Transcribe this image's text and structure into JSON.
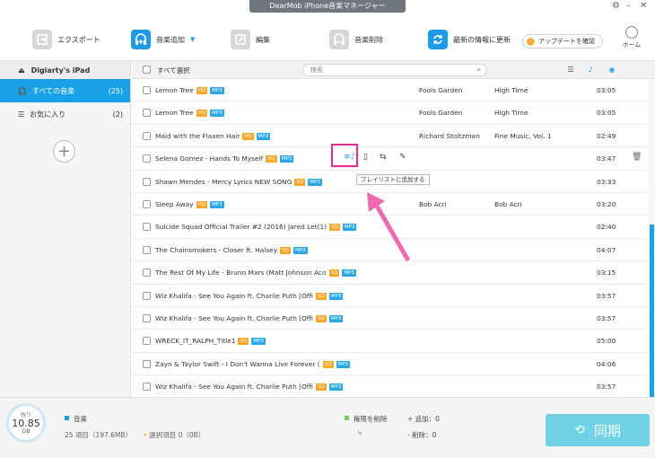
{
  "app": {
    "title": "DearMob iPhone音楽マネージャー"
  },
  "toolbar": {
    "export": "エクスポート",
    "add_music": "音楽追加",
    "edit": "編集",
    "delete_music": "音楽削除",
    "latest_info_update": "最新の情報に更新",
    "check_update": "アップデートを確認",
    "home": "ホーム"
  },
  "sidebar": {
    "device": "Digiarty's iPad",
    "items": [
      {
        "label": "すべての音楽",
        "count": "(25)"
      },
      {
        "label": "お気に入り",
        "count": "(2)"
      }
    ]
  },
  "list": {
    "select_all": "すべて選択",
    "search_placeholder": "検索",
    "tooltip": "プレイリストに追加する",
    "rows": [
      {
        "title": "Lemon Tree",
        "q": "HQ",
        "fmt": "MP3",
        "artist": "Fools Garden",
        "album": "High Time",
        "duration": "03:05"
      },
      {
        "title": "Lemon Tree",
        "q": "HQ",
        "fmt": "MP3",
        "artist": "Fools Garden",
        "album": "High Time",
        "duration": "03:05"
      },
      {
        "title": "Maid with the Flaxen Hair",
        "q": "HQ",
        "fmt": "MP3",
        "artist": "Richard Stoltzman",
        "album": "Fine Music, Vol. 1",
        "duration": "02:49"
      },
      {
        "title": "Selena Gomez - Hands To Myself",
        "q": "HQ",
        "fmt": "MP3",
        "artist": "",
        "album": "",
        "duration": "03:47"
      },
      {
        "title": "Shawn Mendes - Mercy Lyrics NEW SONG",
        "q": "SQ",
        "fmt": "MP3",
        "artist": "",
        "album": "",
        "duration": "03:33"
      },
      {
        "title": "Sleep Away",
        "q": "HQ",
        "fmt": "MP3",
        "artist": "Bob Acri",
        "album": "Bob Acri",
        "duration": "03:20"
      },
      {
        "title": "Suicide Squad Official Trailer #2 (2016) Jared Let(1)",
        "q": "SQ",
        "fmt": "MP3",
        "artist": "",
        "album": "",
        "duration": "02:40"
      },
      {
        "title": "The Chainsmokers - Closer ft. Halsey",
        "q": "SQ",
        "fmt": "MP3",
        "artist": "",
        "album": "",
        "duration": "04:07"
      },
      {
        "title": "The Rest Of My Life - Bruno Mars (Matt Johnson Aco",
        "q": "SQ",
        "fmt": "MP3",
        "artist": "",
        "album": "",
        "duration": "03:15"
      },
      {
        "title": "Wiz Khalifa - See You Again ft. Charlie Puth [Offi",
        "q": "SQ",
        "fmt": "MP3",
        "artist": "",
        "album": "",
        "duration": "03:57"
      },
      {
        "title": "Wiz Khalifa - See You Again ft. Charlie Puth [Offi",
        "q": "SQ",
        "fmt": "MP3",
        "artist": "",
        "album": "",
        "duration": "03:57"
      },
      {
        "title": "WRECK_IT_RALPH_Title1",
        "q": "SQ",
        "fmt": "MP3",
        "artist": "",
        "album": "",
        "duration": "05:00"
      },
      {
        "title": "Zayn & Taylor Swift - I Don't Wanna Live Forever (",
        "q": "SQ",
        "fmt": "MP3",
        "artist": "",
        "album": "",
        "duration": "04:06"
      },
      {
        "title": "Wiz Khalifa - See You Again ft. Charlie Puth [Offi",
        "q": "SQ",
        "fmt": "MP3",
        "artist": "",
        "album": "",
        "duration": "03:57"
      }
    ]
  },
  "bottom": {
    "storage_label": "残り",
    "storage_value": "10.85",
    "storage_unit": "GB",
    "music_label": "音楽",
    "summary": "25 項目（197.6MB）",
    "selected": "選択項目 0（0B）",
    "auth_delete": "権限を削除",
    "add_count": "+ 追加：0",
    "del_count": "- 削除：0",
    "sync": "同期"
  },
  "colors": {
    "accent": "#1aa0e6",
    "highlight": "#e8288a",
    "badge_orange": "#f5a623"
  }
}
